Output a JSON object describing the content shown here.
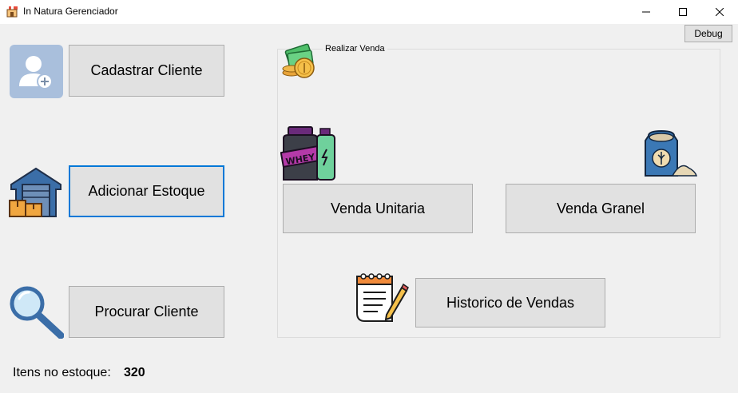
{
  "window": {
    "title": "In Natura Gerenciador",
    "icon": "store-icon"
  },
  "toolbar": {
    "debug_label": "Debug"
  },
  "left_panel": {
    "cadastrar_cliente_label": "Cadastrar Cliente",
    "adicionar_estoque_label": "Adicionar Estoque",
    "procurar_cliente_label": "Procurar Cliente"
  },
  "sale_group": {
    "title": "Realizar Venda",
    "venda_unitaria_label": "Venda Unitaria",
    "venda_granel_label": "Venda Granel",
    "historico_label": "Historico de Vendas"
  },
  "status": {
    "label": "Itens no estoque:",
    "value": "320"
  },
  "colors": {
    "accent": "#0078d7",
    "button_bg": "#e1e1e1",
    "window_bg": "#f0f0f0"
  }
}
